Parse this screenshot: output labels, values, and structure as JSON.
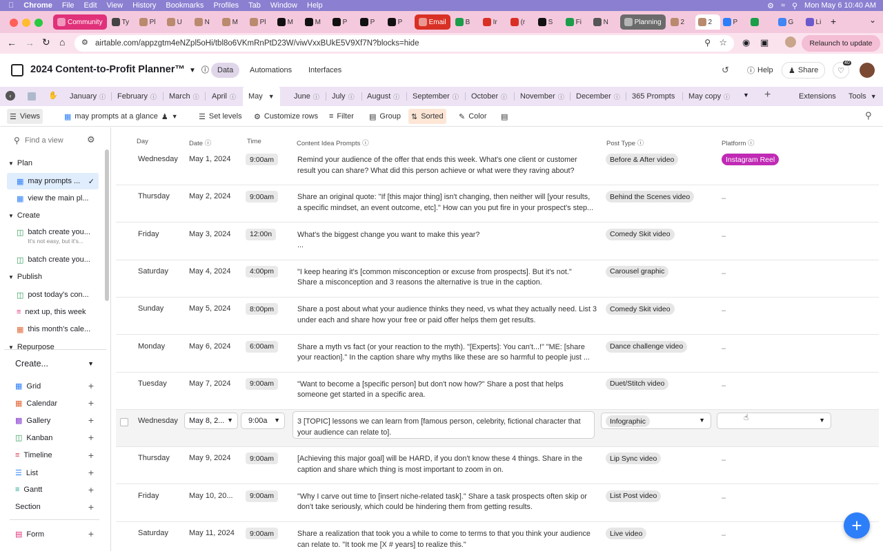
{
  "menubar": {
    "items": [
      "Chrome",
      "File",
      "Edit",
      "View",
      "History",
      "Bookmarks",
      "Profiles",
      "Tab",
      "Window",
      "Help"
    ],
    "datetime": "Mon May 6  10:40 AM"
  },
  "browser_tabs": [
    {
      "label": "Community",
      "color": "#e0317a"
    },
    {
      "label": "Ty",
      "color": "#444"
    },
    {
      "label": "Pl",
      "color": "#b98a6d"
    },
    {
      "label": "U",
      "color": "#b98a6d"
    },
    {
      "label": "N",
      "color": "#b98a6d"
    },
    {
      "label": "M",
      "color": "#b98a6d"
    },
    {
      "label": "Pl",
      "color": "#b98a6d"
    },
    {
      "label": "M",
      "color": "#111"
    },
    {
      "label": "M",
      "color": "#111"
    },
    {
      "label": "P",
      "color": "#111"
    },
    {
      "label": "P",
      "color": "#111"
    },
    {
      "label": "P",
      "color": "#111"
    },
    {
      "label": "Email",
      "color": "#d93025"
    },
    {
      "label": "B",
      "color": "#1a9e4a"
    },
    {
      "label": "Ir",
      "color": "#d93025"
    },
    {
      "label": "(r",
      "color": "#d93025"
    },
    {
      "label": "S",
      "color": "#111"
    },
    {
      "label": "Fi",
      "color": "#1a9e4a"
    },
    {
      "label": "N",
      "color": "#555"
    },
    {
      "label": "Planning",
      "color": "#6b6b6b"
    },
    {
      "label": "2",
      "color": "#b98a6d"
    },
    {
      "label": "2",
      "color": "#b98a6d"
    },
    {
      "label": "P",
      "color": "#2d7ff9"
    },
    {
      "label": "",
      "color": "#1a9e4a"
    },
    {
      "label": "G",
      "color": "#4285f4"
    },
    {
      "label": "Li",
      "color": "#6a5acd"
    }
  ],
  "address": {
    "url": "airtable.com/appzgtm4eNZpl5oHi/tbl8o6VKmRnPtD23W/viwVxxBUkE5V9Xf7N?blocks=hide",
    "relaunch": "Relaunch to update"
  },
  "app": {
    "title": "2024 Content-to-Profit Planner™",
    "nav": [
      "Data",
      "Automations",
      "Interfaces"
    ],
    "help": "Help",
    "share": "Share",
    "notif_count": "40"
  },
  "table_tabs": [
    "January",
    "February",
    "March",
    "April",
    "May",
    "June",
    "July",
    "August",
    "September",
    "October",
    "November",
    "December",
    "365 Prompts",
    "May copy"
  ],
  "table_right": {
    "extensions": "Extensions",
    "tools": "Tools"
  },
  "viewbar": {
    "views": "Views",
    "current_view": "may prompts at a glance",
    "set_levels": "Set levels",
    "customize_rows": "Customize rows",
    "filter": "Filter",
    "group": "Group",
    "sorted": "Sorted",
    "color": "Color"
  },
  "sidebar": {
    "find_placeholder": "Find a view",
    "sections": {
      "plan": "Plan",
      "create": "Create",
      "publish": "Publish",
      "repurpose": "Repurpose"
    },
    "plan_items": [
      "may prompts ...",
      "view the main pl..."
    ],
    "create_items": [
      "batch create you...",
      "batch create you..."
    ],
    "create_sub": "It's not easy, but it's...",
    "publish_items": [
      "post today's con...",
      "next up, this week",
      "this month's cale..."
    ],
    "create_menu": "Create...",
    "view_types": [
      "Grid",
      "Calendar",
      "Gallery",
      "Kanban",
      "Timeline",
      "List",
      "Gantt"
    ],
    "section_label": "Section",
    "form_label": "Form"
  },
  "grid": {
    "headers": {
      "day": "Day",
      "date": "Date",
      "time": "Time",
      "prompt": "Content Idea Prompts",
      "post_type": "Post Type",
      "platform": "Platform"
    },
    "rows": [
      {
        "day": "Wednesday",
        "date": "May 1, 2024",
        "time": "9:00am",
        "p1": "Remind your audience of the offer that ends this week. What's one client or customer",
        "p2": "result you can share? What did this person achieve or what were they raving about?",
        "type": "Before & After video",
        "platform": "Instagram Reel"
      },
      {
        "day": "Thursday",
        "date": "May 2, 2024",
        "time": "9:00am",
        "p1": "Share an original quote: \"If [this major thing] isn't changing, then neither will [your results,",
        "p2": "a specific mindset, an event outcome, etc].\" How can you put fire in your prospect's step...",
        "type": "Behind the Scenes video",
        "platform": "–"
      },
      {
        "day": "Friday",
        "date": "May 3, 2024",
        "time": "12:00n",
        "p1": "What's the biggest change you want to make this year?",
        "p2": "...",
        "type": "Comedy Skit video",
        "platform": "–"
      },
      {
        "day": "Saturday",
        "date": "May 4, 2024",
        "time": "4:00pm",
        "p1": "\"I keep hearing it's [common misconception or excuse from prospects]. But it's not.\"",
        "p2": "Share a misconception and 3 reasons the alternative is true in the caption.",
        "type": "Carousel graphic",
        "platform": "–"
      },
      {
        "day": "Sunday",
        "date": "May 5, 2024",
        "time": "8:00pm",
        "p1": "Share a post about what your audience thinks they need, vs what they actually need. List 3",
        "p2": "under each and share how your free or paid offer helps them get results.",
        "type": "Comedy Skit video",
        "platform": "–"
      },
      {
        "day": "Monday",
        "date": "May 6, 2024",
        "time": "6:00am",
        "p1": "Share a myth vs fact (or your reaction to the myth). \"[Experts]: You can't...!\" \"ME: [share",
        "p2": "your reaction].\" In the caption share why myths like these are so harmful to people just ...",
        "type": "Dance challenge video",
        "platform": "–"
      },
      {
        "day": "Tuesday",
        "date": "May 7, 2024",
        "time": "9:00am",
        "p1": "\"Want to become a [specific person] but don't now how?\" Share a post that helps",
        "p2": "someone get started in a specific area.",
        "type": "Duet/Stitch video",
        "platform": "–"
      },
      {
        "day": "Wednesday",
        "date": "May 8, 2...",
        "time": "9:00a",
        "p1": "3 [TOPIC] lessons we can learn from [famous person, celebrity, fictional character that",
        "p2": "your audience can relate to].",
        "type": "Infographic",
        "platform": ""
      },
      {
        "day": "Thursday",
        "date": "May 9, 2024",
        "time": "9:00am",
        "p1": "[Achieving this major goal] will be HARD, if you don't know these 4 things. Share in the",
        "p2": "caption and share which thing is most important to zoom in on.",
        "type": "Lip Sync video",
        "platform": "–"
      },
      {
        "day": "Friday",
        "date": "May 10, 20...",
        "time": "9:00am",
        "p1": "\"Why I carve out time to [insert niche-related task].\" Share a task prospects often skip or",
        "p2": "don't take seriously, which could be hindering them from getting results.",
        "type": "List Post video",
        "platform": "–"
      },
      {
        "day": "Saturday",
        "date": "May 11, 2024",
        "time": "9:00am",
        "p1": "Share a realization that took you a while to come to terms to that you think your audience",
        "p2": "can relate to. \"It took me [X # years] to realize this.\"",
        "type": "Live video",
        "platform": "–"
      }
    ]
  },
  "colors": {
    "accent": "#2d7ff9",
    "instagram_pill": "#c02bb5",
    "sorted_bg": "#fde6d6"
  }
}
